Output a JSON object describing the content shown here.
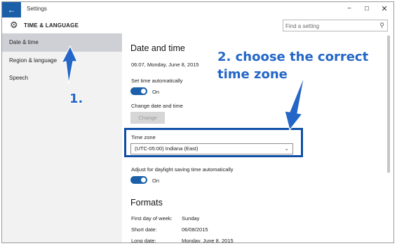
{
  "window": {
    "title": "Settings",
    "back": "←",
    "minimize": "−",
    "maximize": "☐",
    "close": "✕"
  },
  "header": {
    "section": "TIME & LANGUAGE",
    "search_placeholder": "Find a setting"
  },
  "sidebar": {
    "items": [
      {
        "label": "Date & time"
      },
      {
        "label": "Region & language"
      },
      {
        "label": "Speech"
      }
    ]
  },
  "main": {
    "heading": "Date and time",
    "current_datetime": "06:07, Monday, June 8, 2015",
    "set_time_auto_label": "Set time automatically",
    "set_time_auto_state": "On",
    "change_dt_label": "Change date and time",
    "change_button": "Change",
    "time_zone_label": "Time zone",
    "time_zone_value": "(UTC-05:00) Indiana (East)",
    "dst_label": "Adjust for daylight saving time automatically",
    "dst_state": "On",
    "formats_heading": "Formats",
    "formats": [
      {
        "label": "First day of week:",
        "value": "Sunday"
      },
      {
        "label": "Short date:",
        "value": "06/08/2015"
      },
      {
        "label": "Long date:",
        "value": "Monday, June 8, 2015"
      }
    ]
  },
  "annotations": {
    "step1": "1.",
    "step2": "2. choose the correct time zone"
  },
  "colors": {
    "accent": "#1a5fa8",
    "annotation": "#2466c7",
    "frame": "#0e4ea6"
  }
}
